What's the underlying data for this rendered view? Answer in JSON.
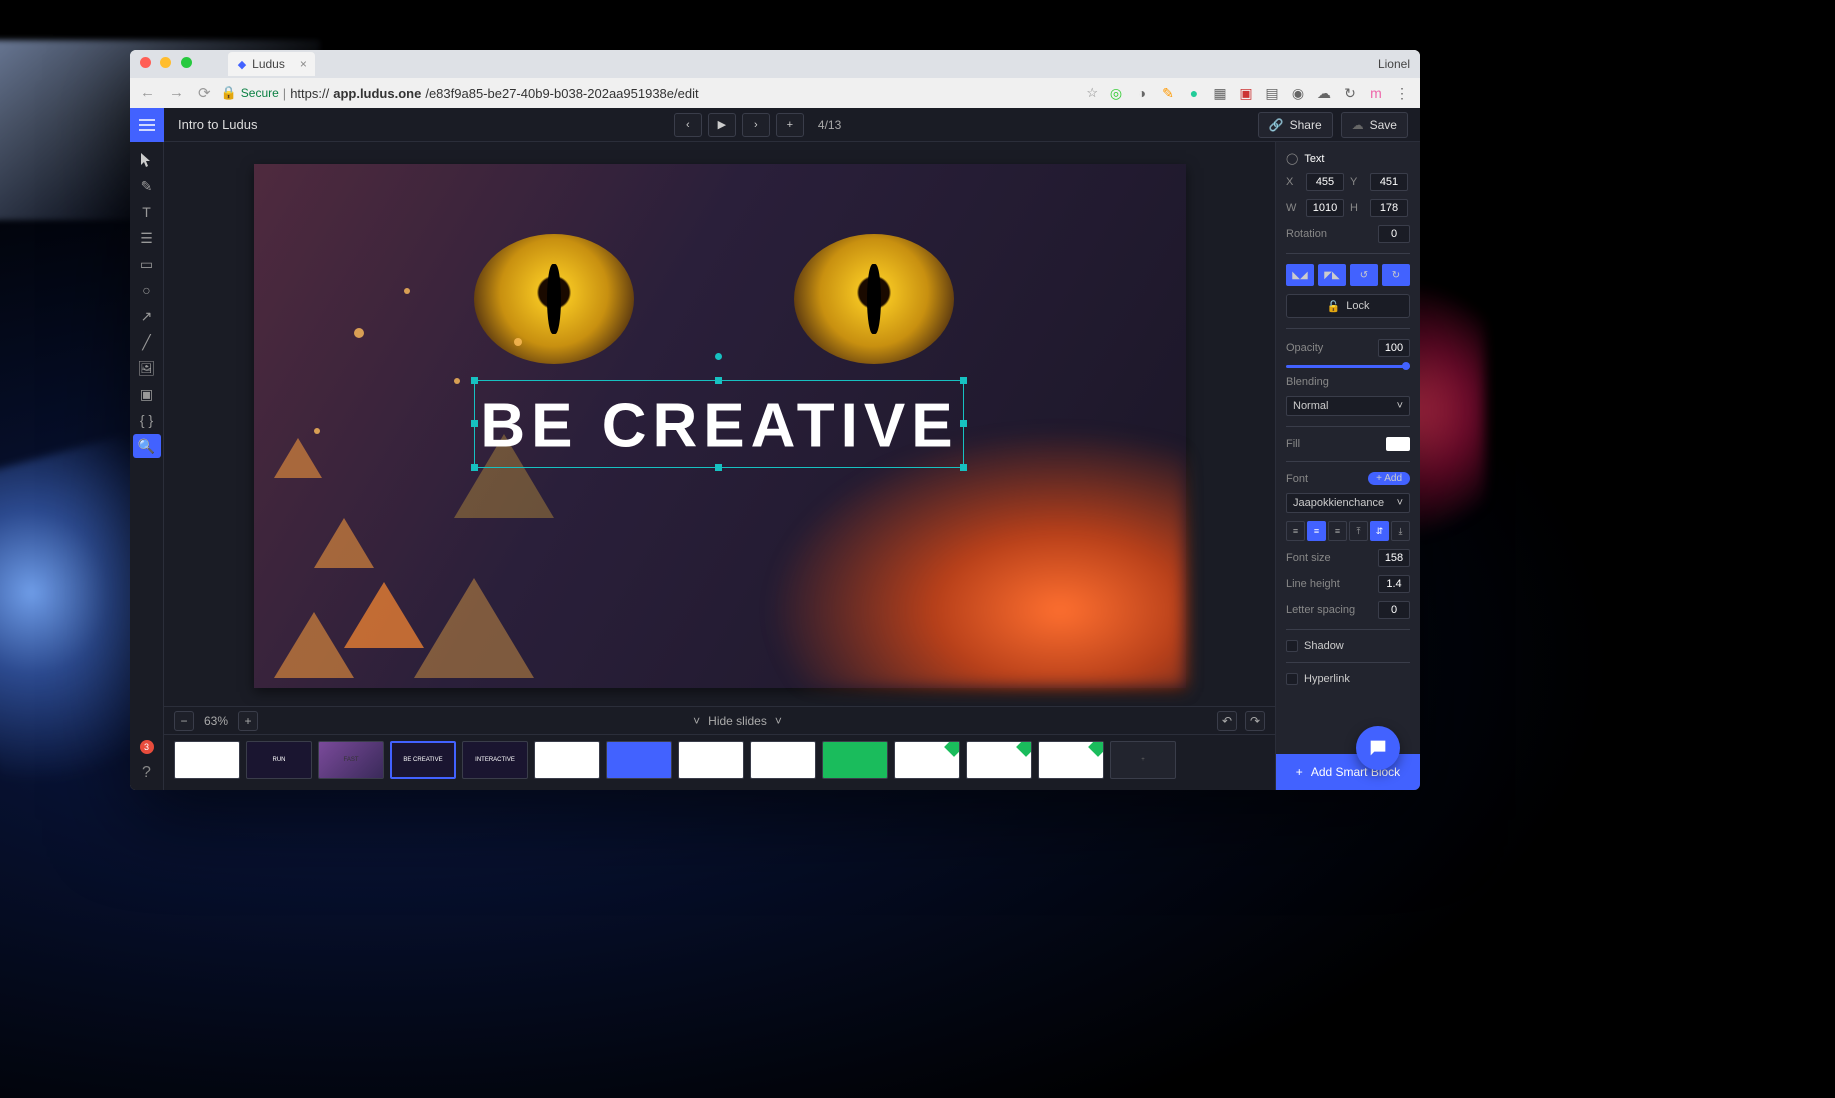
{
  "browser": {
    "tab_title": "Ludus",
    "profile": "Lionel",
    "secure_label": "Secure",
    "url_prefix": "https://",
    "url_host": "app.ludus.one",
    "url_path": "/e83f9a85-be27-40b9-b038-202aa951938e/edit"
  },
  "topbar": {
    "presentation_name": "Intro to Ludus",
    "slide_counter": "4/13",
    "share_label": "Share",
    "save_label": "Save"
  },
  "canvas": {
    "headline": "BE CREATIVE",
    "zoom": "63%",
    "hide_slides_label": "Hide slides"
  },
  "thumbs": [
    {
      "style": "light",
      "label": ""
    },
    {
      "style": "dark",
      "label": "RUN"
    },
    {
      "style": "purple",
      "label": "FAST"
    },
    {
      "style": "dark",
      "label": "BE CREATIVE",
      "active": true
    },
    {
      "style": "dark",
      "label": "INTERACTIVE"
    },
    {
      "style": "light",
      "label": ""
    },
    {
      "style": "blue",
      "label": ""
    },
    {
      "style": "light",
      "label": ""
    },
    {
      "style": "light",
      "label": ""
    },
    {
      "style": "green",
      "label": "",
      "badge": true
    },
    {
      "style": "light",
      "label": "",
      "badge": true
    },
    {
      "style": "light",
      "label": "",
      "badge": true
    },
    {
      "style": "light",
      "label": "",
      "badge": true
    },
    {
      "style": "add",
      "label": "+"
    }
  ],
  "inspector": {
    "type_label": "Text",
    "x_label": "X",
    "x": "455",
    "y_label": "Y",
    "y": "451",
    "w_label": "W",
    "w": "1010",
    "h_label": "H",
    "h": "178",
    "rotation_label": "Rotation",
    "rotation": "0",
    "lock_label": "Lock",
    "opacity_label": "Opacity",
    "opacity": "100",
    "blending_label": "Blending",
    "blending": "Normal",
    "fill_label": "Fill",
    "fill_color": "#ffffff",
    "font_label": "Font",
    "add_label": "+ Add",
    "font_family": "Jaapokkienchance",
    "font_size_label": "Font size",
    "font_size": "158",
    "line_height_label": "Line height",
    "line_height": "1.4",
    "letter_spacing_label": "Letter spacing",
    "letter_spacing": "0",
    "shadow_label": "Shadow",
    "hyperlink_label": "Hyperlink",
    "add_smart_label": "Add Smart Block"
  },
  "notifications": "3"
}
